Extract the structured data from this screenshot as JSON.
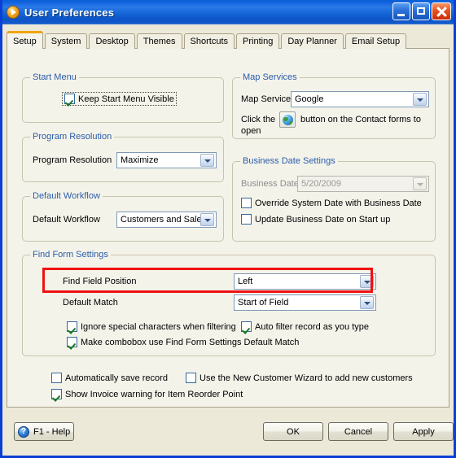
{
  "window": {
    "title": "User Preferences",
    "icon": "orange-play-icon",
    "controls": {
      "minimize": "minimize-button",
      "maximize": "maximize-button",
      "close": "close-button"
    }
  },
  "tabs": [
    {
      "label": "Setup",
      "active": true
    },
    {
      "label": "System",
      "active": false
    },
    {
      "label": "Desktop",
      "active": false
    },
    {
      "label": "Themes",
      "active": false
    },
    {
      "label": "Shortcuts",
      "active": false
    },
    {
      "label": "Printing",
      "active": false
    },
    {
      "label": "Day Planner",
      "active": false
    },
    {
      "label": "Email Setup",
      "active": false
    }
  ],
  "groups": {
    "start_menu": {
      "legend": "Start Menu",
      "keep_visible_label": "Keep Start Menu Visible",
      "keep_visible_checked": true
    },
    "program_resolution": {
      "legend": "Program Resolution",
      "label": "Program Resolution",
      "value": "Maximize"
    },
    "default_workflow": {
      "legend": "Default Workflow",
      "label": "Default Workflow",
      "value": "Customers and Sales"
    },
    "map_services": {
      "legend": "Map Services",
      "service_label": "Map Service",
      "service_value": "Google",
      "hint_before": "Click the",
      "hint_after": "button on the Contact forms to",
      "hint_line2": "open",
      "button_icon": "globe-icon"
    },
    "business_date": {
      "legend": "Business Date Settings",
      "date_label": "Business Date",
      "date_value": "5/20/2009",
      "date_disabled": true,
      "override_label": "Override System Date with Business Date",
      "override_checked": false,
      "update_label": "Update Business Date on Start up",
      "update_checked": false
    },
    "find_form": {
      "legend": "Find Form Settings",
      "find_position_label": "Find Field Position",
      "find_position_value": "Left",
      "default_match_label": "Default Match",
      "default_match_value": "Start of Field",
      "ignore_special_label": "Ignore special characters when filtering",
      "ignore_special_checked": true,
      "auto_filter_label": "Auto filter record as you type",
      "auto_filter_checked": true,
      "combobox_match_label": "Make combobox use Find Form Settings Default Match",
      "combobox_match_checked": true
    }
  },
  "misc_options": {
    "auto_save_label": "Automatically save record",
    "auto_save_checked": false,
    "new_customer_wizard_label": "Use the New Customer Wizard to add new customers",
    "new_customer_wizard_checked": false,
    "invoice_warning_label": "Show Invoice warning for Item Reorder Point",
    "invoice_warning_checked": true
  },
  "buttons": {
    "help": "F1 - Help",
    "ok": "OK",
    "cancel": "Cancel",
    "apply": "Apply"
  },
  "annotation": {
    "type": "red-highlight-rectangle",
    "target": "Find Field Position"
  },
  "colors": {
    "titlebar_blue": "#1667d8",
    "frame_blue": "#0a3fd6",
    "panel_bg": "#f4f3ea",
    "dialog_bg": "#ece9d8",
    "legend_text": "#2a5caa",
    "active_tab_accent": "#f0a30a",
    "highlight_red": "#ee1111",
    "check_green": "#1a7a22"
  }
}
